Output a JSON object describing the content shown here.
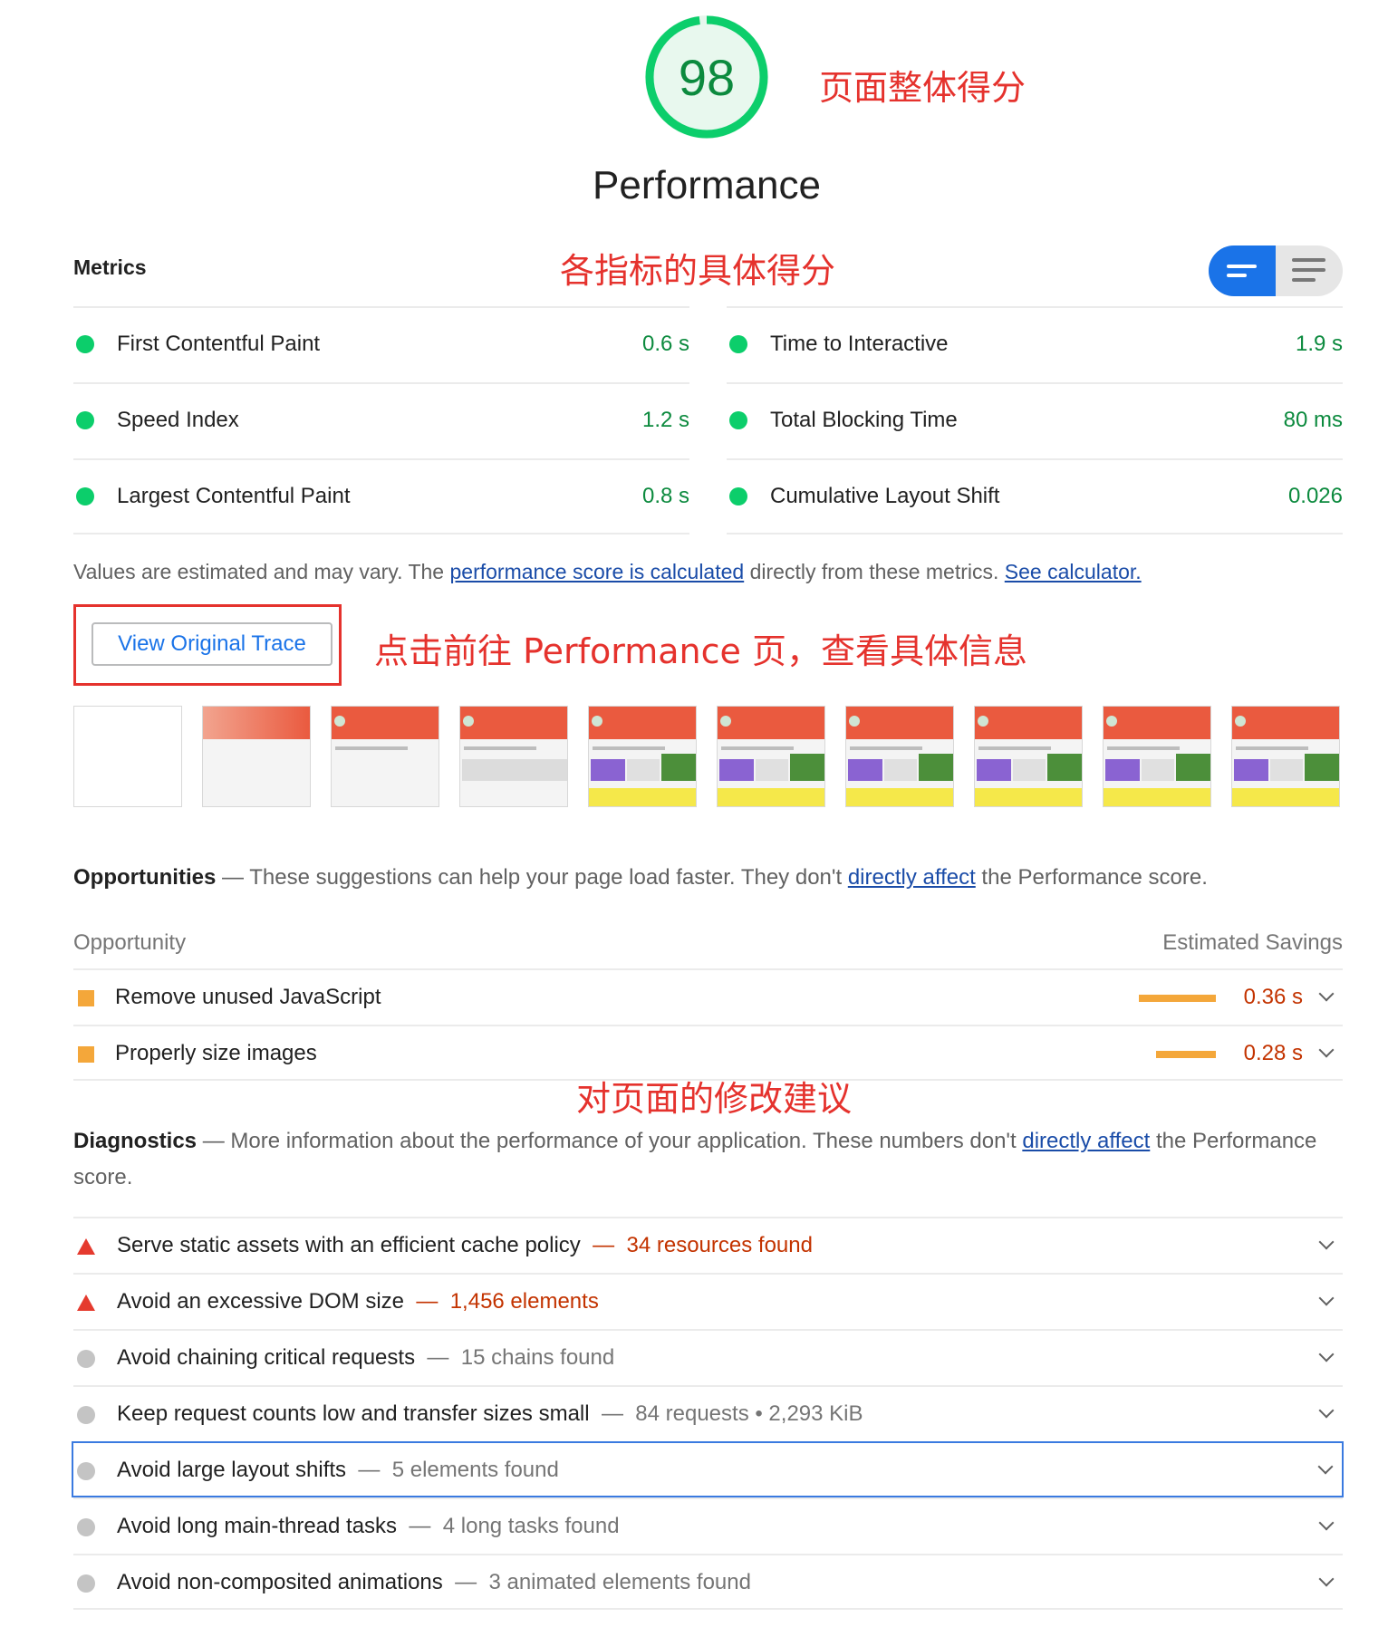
{
  "gauge": {
    "score": "98",
    "score_fraction": 0.98,
    "color": "#0cce6b"
  },
  "category_title": "Performance",
  "annotations": {
    "overall": "页面整体得分",
    "metrics": "各指标的具体得分",
    "trace": "点击前往 Performance 页，查看具体信息",
    "suggestions": "对页面的修改建议"
  },
  "metrics": {
    "title": "Metrics",
    "left": [
      {
        "label": "First Contentful Paint",
        "value": "0.6 s"
      },
      {
        "label": "Speed Index",
        "value": "1.2 s"
      },
      {
        "label": "Largest Contentful Paint",
        "value": "0.8 s"
      }
    ],
    "right": [
      {
        "label": "Time to Interactive",
        "value": "1.9 s"
      },
      {
        "label": "Total Blocking Time",
        "value": "80 ms"
      },
      {
        "label": "Cumulative Layout Shift",
        "value": "0.026"
      }
    ]
  },
  "note": {
    "prefix": "Values are estimated and may vary. The ",
    "link1": "performance score is calculated",
    "middle": " directly from these metrics.",
    "link2": "See calculator."
  },
  "trace_button": "View Original Trace",
  "filmstrip_count": 10,
  "opportunities": {
    "title": "Opportunities",
    "dash": " — ",
    "desc_prefix": "These suggestions can help your page load faster. They don't ",
    "desc_link": "directly affect",
    "desc_suffix": " the Performance score.",
    "col_left": "Opportunity",
    "col_right": "Estimated Savings",
    "items": [
      {
        "label": "Remove unused JavaScript",
        "value": "0.36 s",
        "bar_fraction": 0.36
      },
      {
        "label": "Properly size images",
        "value": "0.28 s",
        "bar_fraction": 0.28
      }
    ]
  },
  "diagnostics": {
    "title": "Diagnostics",
    "dash": " — ",
    "desc_prefix": "More information about the performance of your application. These numbers don't ",
    "desc_link": "directly affect",
    "desc_suffix": " the Performance score.",
    "items": [
      {
        "label": "Serve static assets with an efficient cache policy",
        "dash": "—",
        "detail": "34 resources found",
        "status": "fail"
      },
      {
        "label": "Avoid an excessive DOM size",
        "dash": "—",
        "detail": "1,456 elements",
        "status": "fail"
      },
      {
        "label": "Avoid chaining critical requests",
        "dash": "—",
        "detail": "15 chains found",
        "status": "info"
      },
      {
        "label": "Keep request counts low and transfer sizes small",
        "dash": "—",
        "detail": "84 requests • 2,293 KiB",
        "status": "info"
      },
      {
        "label": "Avoid large layout shifts",
        "dash": "—",
        "detail": "5 elements found",
        "status": "info"
      },
      {
        "label": "Avoid long main-thread tasks",
        "dash": "—",
        "detail": "4 long tasks found",
        "status": "info"
      },
      {
        "label": "Avoid non-composited animations",
        "dash": "—",
        "detail": "3 animated elements found",
        "status": "info"
      }
    ]
  }
}
